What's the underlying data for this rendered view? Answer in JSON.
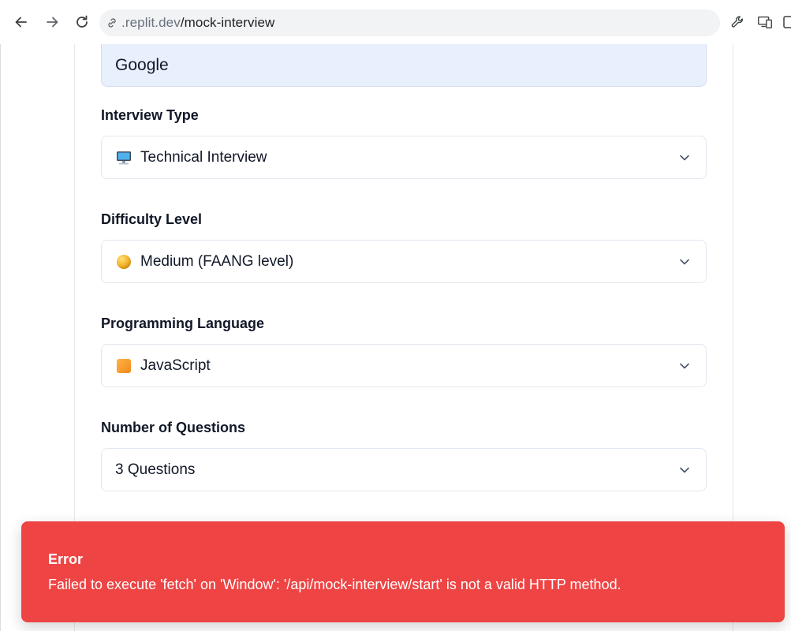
{
  "browser": {
    "url_host": ".replit.dev",
    "url_path": "/mock-interview"
  },
  "form": {
    "company_value": "Google",
    "interview_type": {
      "label": "Interview Type",
      "value": "Technical Interview",
      "icon": "computer-icon"
    },
    "difficulty": {
      "label": "Difficulty Level",
      "value": "Medium (FAANG level)",
      "icon": "yellow-circle-icon"
    },
    "language": {
      "label": "Programming Language",
      "value": "JavaScript",
      "icon": "orange-square-icon"
    },
    "questions": {
      "label": "Number of Questions",
      "value": "3 Questions"
    }
  },
  "toast": {
    "title": "Error",
    "message": "Failed to execute 'fetch' on 'Window': '/api/mock-interview/start' is not a valid HTTP method.",
    "color": "#ef4444"
  }
}
